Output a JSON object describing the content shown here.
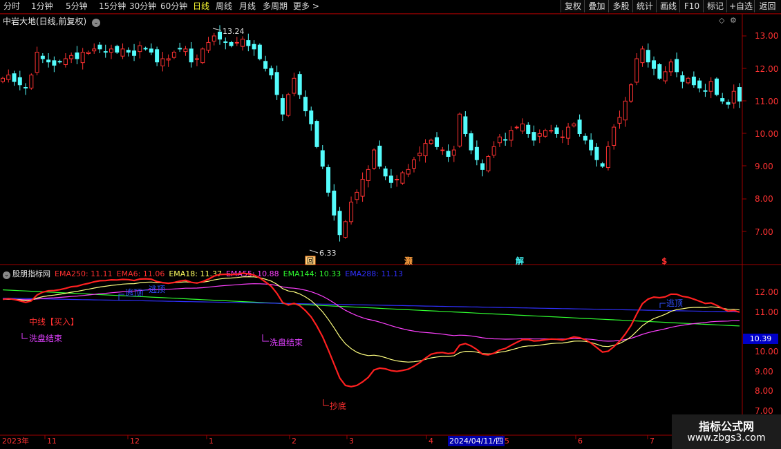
{
  "toolbar": {
    "periods": [
      "分时",
      "1分钟",
      "5分钟",
      "15分钟",
      "30分钟",
      "60分钟",
      "日线",
      "周线",
      "月线",
      "多周期",
      "更多 >"
    ],
    "active_period": "日线",
    "right_buttons": [
      "复权",
      "叠加",
      "多股",
      "统计",
      "画线",
      "F10",
      "标记",
      "+自选",
      "返回"
    ]
  },
  "main_chart": {
    "title": "中岩大地(日线,前复权)",
    "price_ticks": [
      "13.00",
      "12.00",
      "11.00",
      "10.00",
      "9.00",
      "8.00",
      "7.00"
    ],
    "high_label": "13.24",
    "low_label": "6.33",
    "markers": [
      "回",
      "灏",
      "解",
      "$"
    ]
  },
  "indicator": {
    "name": "股朋指标网",
    "legend": [
      {
        "text": "EMA250: 11.11",
        "color": "#ff3030"
      },
      {
        "text": "EMA6: 11.06",
        "color": "#ff3030"
      },
      {
        "text": "EMA18: 11.37",
        "color": "#ffff60"
      },
      {
        "text": "EMA55: 10.88",
        "color": "#ff40ff"
      },
      {
        "text": "EMA144: 10.33",
        "color": "#30ff30"
      },
      {
        "text": "EMA288: 11.13",
        "color": "#3030ff"
      }
    ],
    "ticks": [
      "12.00",
      "11.00",
      "10.00",
      "9.00",
      "8.00",
      "7.00"
    ],
    "current_value": "10.39",
    "annotations": {
      "escape_top_1": "逃顶",
      "escape_top_2": "逃顶",
      "escape_top_3": "逃顶",
      "mid_buy": "中线【买入】",
      "wash_end_1": "洗盘结束",
      "wash_end_2": "洗盘结束",
      "bottom_buy": "抄底"
    }
  },
  "x_axis": {
    "labels": [
      "2023年",
      "11",
      "12",
      "1",
      "2",
      "3",
      "4",
      "5",
      "6",
      "7"
    ],
    "date_label": "2024/04/11/四"
  },
  "watermark": {
    "title": "指标公式网",
    "url": "www.zbgs3.com"
  },
  "colors": {
    "up": "#ff3232",
    "down": "#54fcfc",
    "axis": "#a00000"
  },
  "chart_data": {
    "type": "candlestick",
    "title": "中岩大地(日线,前复权)",
    "ylim": [
      6.0,
      13.5
    ],
    "annotated_high": 13.24,
    "annotated_low": 6.33,
    "close_series": [
      11.7,
      11.8,
      11.6,
      11.5,
      11.4,
      11.8,
      12.5,
      12.3,
      12.2,
      12.1,
      12.2,
      12.3,
      12.4,
      12.3,
      12.5,
      12.5,
      12.6,
      12.6,
      12.5,
      12.6,
      12.5,
      12.6,
      12.5,
      12.4,
      12.7,
      12.6,
      12.5,
      12.2,
      12.3,
      12.3,
      12.5,
      12.6,
      12.6,
      12.2,
      12.3,
      12.6,
      12.8,
      13.0,
      12.9,
      12.8,
      12.7,
      12.8,
      12.9,
      12.7,
      12.6,
      12.3,
      12.0,
      11.8,
      11.2,
      10.6,
      11.2,
      11.7,
      11.2,
      10.7,
      10.3,
      9.6,
      9.0,
      8.2,
      7.5,
      6.9,
      7.3,
      7.9,
      8.2,
      8.6,
      8.9,
      9.5,
      9.0,
      8.7,
      8.5,
      8.6,
      8.8,
      8.9,
      9.2,
      9.4,
      9.7,
      9.8,
      9.6,
      9.5,
      9.3,
      9.5,
      10.6,
      10.0,
      9.5,
      9.2,
      8.9,
      9.3,
      9.6,
      9.9,
      9.8,
      10.1,
      10.2,
      10.3,
      10.0,
      9.8,
      10.0,
      10.1,
      10.1,
      10.0,
      9.9,
      10.2,
      10.3,
      10.0,
      9.8,
      9.5,
      9.2,
      9.0,
      9.6,
      10.2,
      10.5,
      11.0,
      11.5,
      12.3,
      12.6,
      12.2,
      12.0,
      11.7,
      11.9,
      12.2,
      11.9,
      11.6,
      11.7,
      11.5,
      11.4,
      11.3,
      11.6,
      11.2,
      11.0,
      10.9,
      11.3,
      11.0
    ],
    "x_tick_labels": [
      "2023年",
      "11",
      "12",
      "1",
      "2",
      "3",
      "4",
      "5",
      "6",
      "7"
    ],
    "indicator": {
      "series": [
        {
          "name": "EMA250",
          "last": 11.11
        },
        {
          "name": "EMA6",
          "last": 11.06
        },
        {
          "name": "EMA18",
          "last": 11.37
        },
        {
          "name": "EMA55",
          "last": 10.88
        },
        {
          "name": "EMA144",
          "last": 10.33
        },
        {
          "name": "EMA288",
          "last": 11.13
        }
      ],
      "ylim": [
        6.5,
        13.0
      ]
    }
  }
}
